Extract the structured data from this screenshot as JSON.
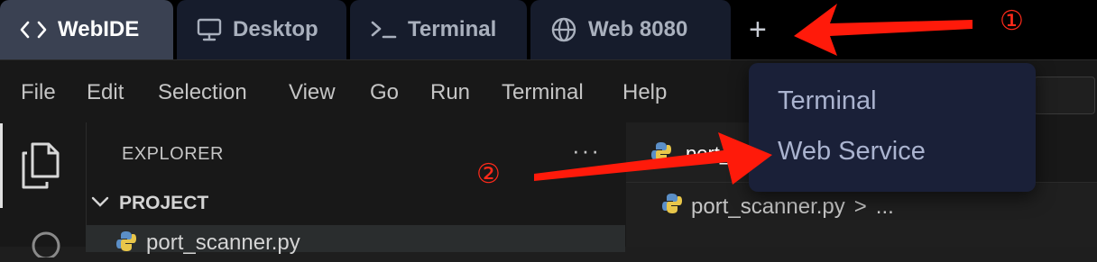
{
  "workspace_tabs": [
    {
      "label": "WebIDE",
      "icon": "code-brackets-icon",
      "active": true
    },
    {
      "label": "Desktop",
      "icon": "monitor-icon",
      "active": false
    },
    {
      "label": "Terminal",
      "icon": "terminal-prompt-icon",
      "active": false
    },
    {
      "label": "Web 8080",
      "icon": "globe-icon",
      "active": false
    }
  ],
  "add_tab": {
    "label": "+"
  },
  "menu": [
    "File",
    "Edit",
    "Selection",
    "View",
    "Go",
    "Run",
    "Terminal",
    "Help"
  ],
  "explorer": {
    "title": "EXPLORER",
    "more": "···",
    "project": {
      "label": "PROJECT",
      "files": [
        "port_scanner.py"
      ]
    }
  },
  "editor": {
    "tab_label": "port_scanner.py",
    "breadcrumb": {
      "file": "port_scanner.py",
      "separator": ">",
      "rest": "..."
    }
  },
  "dropdown": {
    "items": [
      "Terminal",
      "Web Service"
    ]
  },
  "annotations": {
    "marker_1": "①",
    "marker_2": "②"
  },
  "colors": {
    "accent_arrow": "#ff1a0a",
    "dropdown_bg": "#1a2038",
    "active_tab_bg": "#3a4152"
  }
}
